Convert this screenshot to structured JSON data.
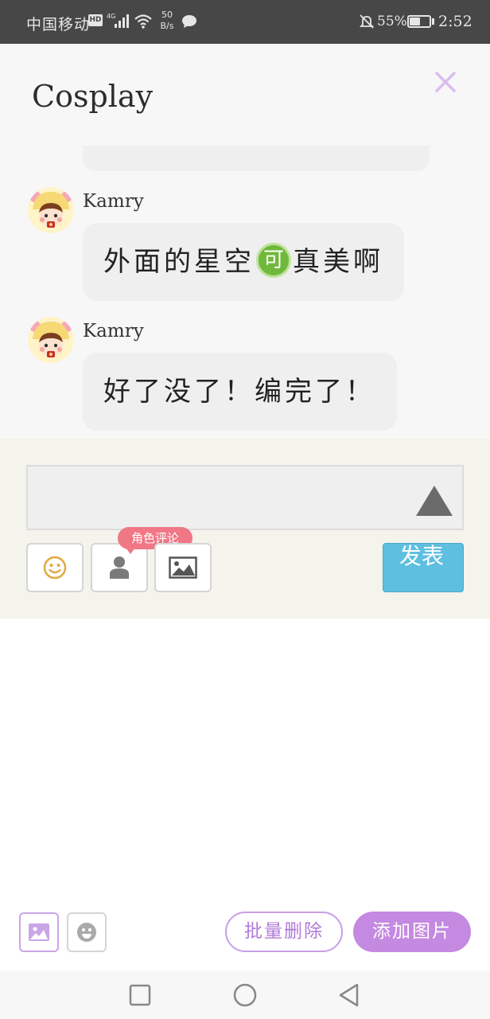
{
  "status_bar": {
    "carrier": "中国移动",
    "hd_badge": "HD",
    "speed_value": "50",
    "speed_unit": "B/s",
    "battery_percent": "55%",
    "battery_level": 0.55,
    "time": "2:52"
  },
  "chat": {
    "title": "Cosplay",
    "messages": [
      {
        "author": "Kamry",
        "text_before": "外面的星空",
        "emoji": "可",
        "text_after": "真美啊"
      },
      {
        "author": "Kamry",
        "text_before": "好了没了！编完了！",
        "emoji": "",
        "text_after": ""
      }
    ]
  },
  "compose": {
    "input_value": "",
    "role_comment_tip": "角色评论",
    "publish_label": "发表"
  },
  "bottom_toolbar": {
    "batch_delete_label": "批量删除",
    "add_image_label": "添加图片"
  },
  "icons": {
    "close": "close-icon",
    "emoji": "smiley-icon",
    "role": "person-icon",
    "image": "image-icon",
    "sticker": "sticker-face-icon"
  },
  "colors": {
    "accent_purple": "#c489e0",
    "publish_blue": "#5fbfe0",
    "tip_pink": "#f07785"
  }
}
